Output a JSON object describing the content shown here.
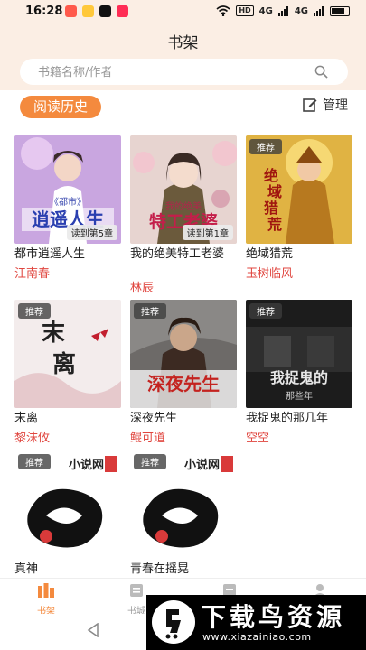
{
  "status": {
    "time": "16:28",
    "hd": "HD",
    "net1": "4G",
    "net2": "4G"
  },
  "header": {
    "title": "书架"
  },
  "search": {
    "placeholder": "书籍名称/作者"
  },
  "toolbar": {
    "history_label": "阅读历史",
    "manage_label": "管理"
  },
  "books": [
    {
      "title": "都市逍遥人生",
      "author": "江南春",
      "progress": "读到第5章",
      "tag": "",
      "cover_text": "都市 逍遥人生"
    },
    {
      "title": "我的绝美特工老婆",
      "author": "林辰",
      "progress": "读到第1章",
      "tag": "",
      "cover_text": "我的绝美 特工老婆"
    },
    {
      "title": "绝域猎荒",
      "author": "玉树临风",
      "progress": "",
      "tag": "推荐",
      "cover_text": "绝域猎荒"
    },
    {
      "title": "末离",
      "author": "黎沫攸",
      "progress": "",
      "tag": "推荐",
      "cover_text": "末离"
    },
    {
      "title": "深夜先生",
      "author": "鲲可道",
      "progress": "",
      "tag": "推荐",
      "cover_text": "深夜先生"
    },
    {
      "title": "我捉鬼的那几年",
      "author": "空空",
      "progress": "",
      "tag": "推荐",
      "cover_text": "我捉鬼的 那些年"
    },
    {
      "title": "真神",
      "author": "",
      "progress": "",
      "tag": "推荐",
      "cover_text": "小说网"
    },
    {
      "title": "青春在摇晃",
      "author": "",
      "progress": "",
      "tag": "推荐",
      "cover_text": "小说网"
    }
  ],
  "tabs": [
    {
      "label": "书架",
      "icon": "bookshelf-icon",
      "active": true
    },
    {
      "label": "书城",
      "icon": "bookstore-icon",
      "active": false
    },
    {
      "label": "",
      "icon": "category-icon",
      "active": false
    },
    {
      "label": "",
      "icon": "profile-icon",
      "active": false
    }
  ],
  "watermark": {
    "title": "下载鸟资源",
    "url": "www.xiazainiao.com"
  },
  "colors": {
    "accent": "#f48a3e",
    "author": "#e0463f",
    "header_bg": "#fbeee4"
  }
}
